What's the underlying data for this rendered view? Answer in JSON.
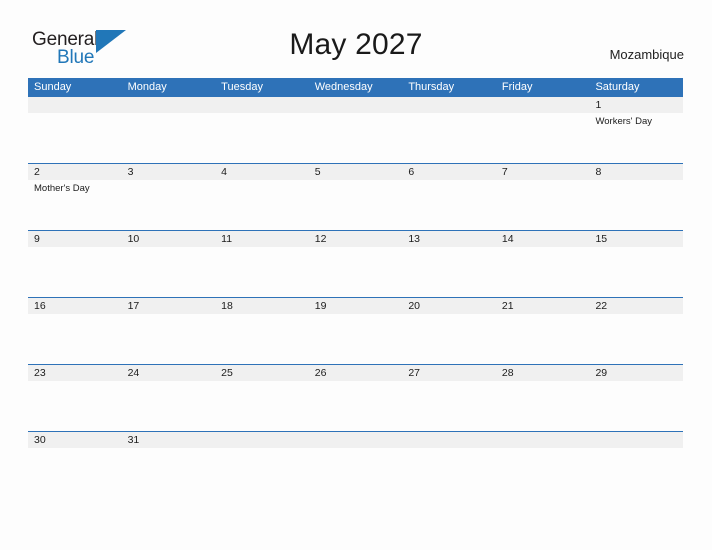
{
  "logo": {
    "word_one": "General",
    "word_two": "Blue",
    "flag_icon": "blue-flag-triangle",
    "color_dark": "#231f20",
    "color_blue": "#2177b8"
  },
  "header": {
    "title": "May 2027",
    "country": "Mozambique"
  },
  "theme": {
    "header_blue": "#2e72b8",
    "row_line_blue": "#2e72b8",
    "daynum_band": "#f0f0f0",
    "page_background": "#fdfdfd"
  },
  "calendar": {
    "weekdays": [
      "Sunday",
      "Monday",
      "Tuesday",
      "Wednesday",
      "Thursday",
      "Friday",
      "Saturday"
    ],
    "weeks": [
      [
        {
          "day": "",
          "event": ""
        },
        {
          "day": "",
          "event": ""
        },
        {
          "day": "",
          "event": ""
        },
        {
          "day": "",
          "event": ""
        },
        {
          "day": "",
          "event": ""
        },
        {
          "day": "",
          "event": ""
        },
        {
          "day": "1",
          "event": "Workers' Day"
        }
      ],
      [
        {
          "day": "2",
          "event": "Mother's Day"
        },
        {
          "day": "3",
          "event": ""
        },
        {
          "day": "4",
          "event": ""
        },
        {
          "day": "5",
          "event": ""
        },
        {
          "day": "6",
          "event": ""
        },
        {
          "day": "7",
          "event": ""
        },
        {
          "day": "8",
          "event": ""
        }
      ],
      [
        {
          "day": "9",
          "event": ""
        },
        {
          "day": "10",
          "event": ""
        },
        {
          "day": "11",
          "event": ""
        },
        {
          "day": "12",
          "event": ""
        },
        {
          "day": "13",
          "event": ""
        },
        {
          "day": "14",
          "event": ""
        },
        {
          "day": "15",
          "event": ""
        }
      ],
      [
        {
          "day": "16",
          "event": ""
        },
        {
          "day": "17",
          "event": ""
        },
        {
          "day": "18",
          "event": ""
        },
        {
          "day": "19",
          "event": ""
        },
        {
          "day": "20",
          "event": ""
        },
        {
          "day": "21",
          "event": ""
        },
        {
          "day": "22",
          "event": ""
        }
      ],
      [
        {
          "day": "23",
          "event": ""
        },
        {
          "day": "24",
          "event": ""
        },
        {
          "day": "25",
          "event": ""
        },
        {
          "day": "26",
          "event": ""
        },
        {
          "day": "27",
          "event": ""
        },
        {
          "day": "28",
          "event": ""
        },
        {
          "day": "29",
          "event": ""
        }
      ],
      [
        {
          "day": "30",
          "event": ""
        },
        {
          "day": "31",
          "event": ""
        },
        {
          "day": "",
          "event": ""
        },
        {
          "day": "",
          "event": ""
        },
        {
          "day": "",
          "event": ""
        },
        {
          "day": "",
          "event": ""
        },
        {
          "day": "",
          "event": ""
        }
      ]
    ]
  }
}
